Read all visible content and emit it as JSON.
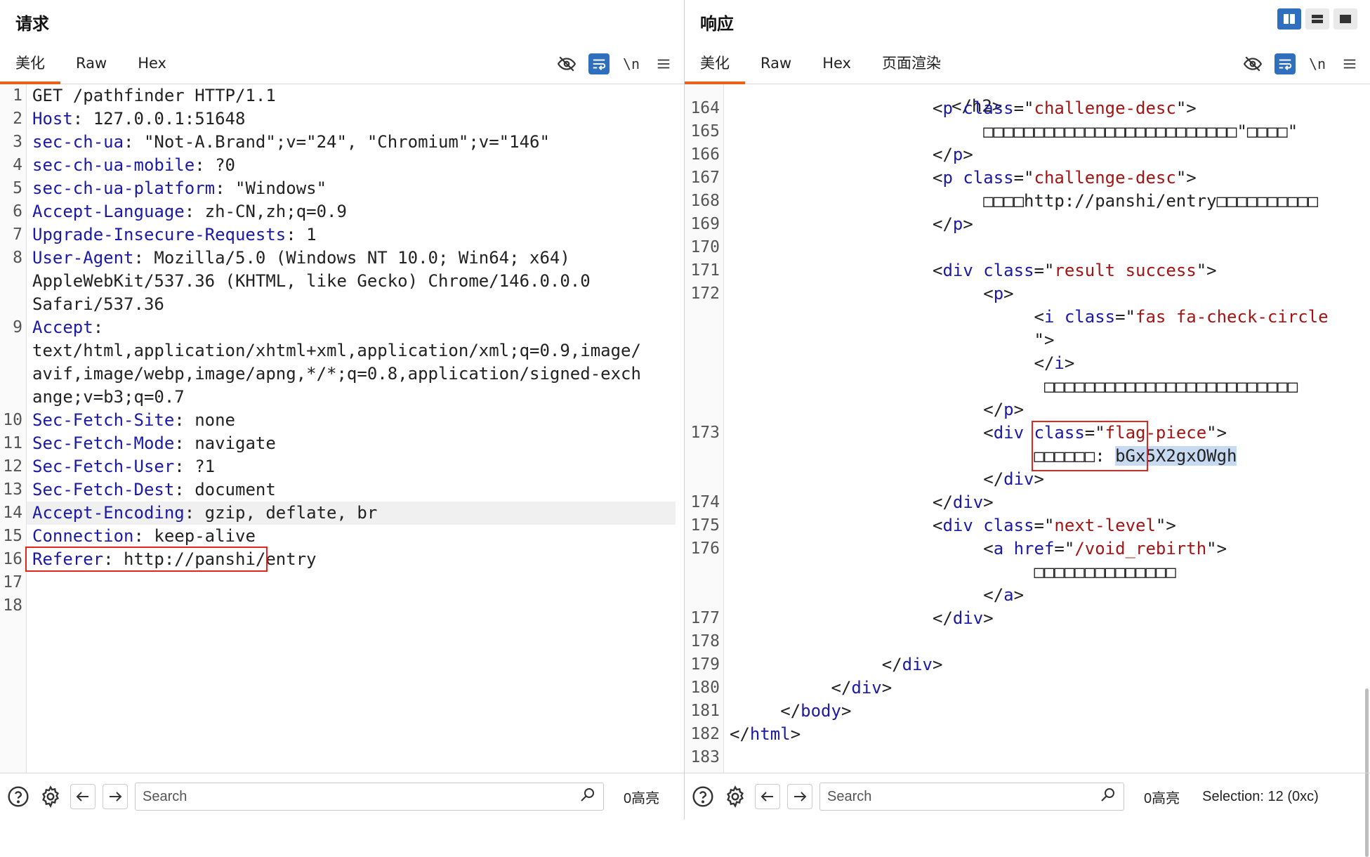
{
  "request": {
    "title": "请求",
    "tabs": [
      "美化",
      "Raw",
      "Hex"
    ],
    "active_tab": "美化",
    "newline_label": "\\n",
    "lines": [
      {
        "n": "1",
        "parts": [
          {
            "c": "v",
            "t": "GET /pathfinder HTTP/1.1"
          }
        ]
      },
      {
        "n": "2",
        "parts": [
          {
            "c": "k",
            "t": "Host"
          },
          {
            "c": "v",
            "t": ": 127.0.0.1:51648"
          }
        ]
      },
      {
        "n": "3",
        "parts": [
          {
            "c": "k",
            "t": "sec-ch-ua"
          },
          {
            "c": "v",
            "t": ": \"Not-A.Brand\";v=\"24\", \"Chromium\";v=\"146\""
          }
        ]
      },
      {
        "n": "4",
        "parts": [
          {
            "c": "k",
            "t": "sec-ch-ua-mobile"
          },
          {
            "c": "v",
            "t": ": ?0"
          }
        ]
      },
      {
        "n": "5",
        "parts": [
          {
            "c": "k",
            "t": "sec-ch-ua-platform"
          },
          {
            "c": "v",
            "t": ": \"Windows\""
          }
        ]
      },
      {
        "n": "6",
        "parts": [
          {
            "c": "k",
            "t": "Accept-Language"
          },
          {
            "c": "v",
            "t": ": zh-CN,zh;q=0.9"
          }
        ]
      },
      {
        "n": "7",
        "parts": [
          {
            "c": "k",
            "t": "Upgrade-Insecure-Requests"
          },
          {
            "c": "v",
            "t": ": 1"
          }
        ]
      },
      {
        "n": "8",
        "parts": [
          {
            "c": "k",
            "t": "User-Agent"
          },
          {
            "c": "v",
            "t": ": Mozilla/5.0 (Windows NT 10.0; Win64; x64)"
          }
        ]
      },
      {
        "n": "",
        "parts": [
          {
            "c": "v",
            "t": "AppleWebKit/537.36 (KHTML, like Gecko) Chrome/146.0.0.0"
          }
        ]
      },
      {
        "n": "",
        "parts": [
          {
            "c": "v",
            "t": "Safari/537.36"
          }
        ]
      },
      {
        "n": "9",
        "parts": [
          {
            "c": "k",
            "t": "Accept"
          },
          {
            "c": "v",
            "t": ":"
          }
        ]
      },
      {
        "n": "",
        "parts": [
          {
            "c": "v",
            "t": "text/html,application/xhtml+xml,application/xml;q=0.9,image/"
          }
        ]
      },
      {
        "n": "",
        "parts": [
          {
            "c": "v",
            "t": "avif,image/webp,image/apng,*/*;q=0.8,application/signed-exch"
          }
        ]
      },
      {
        "n": "",
        "parts": [
          {
            "c": "v",
            "t": "ange;v=b3;q=0.7"
          }
        ]
      },
      {
        "n": "10",
        "parts": [
          {
            "c": "k",
            "t": "Sec-Fetch-Site"
          },
          {
            "c": "v",
            "t": ": none"
          }
        ]
      },
      {
        "n": "11",
        "parts": [
          {
            "c": "k",
            "t": "Sec-Fetch-Mode"
          },
          {
            "c": "v",
            "t": ": navigate"
          }
        ]
      },
      {
        "n": "12",
        "parts": [
          {
            "c": "k",
            "t": "Sec-Fetch-User"
          },
          {
            "c": "v",
            "t": ": ?1"
          }
        ]
      },
      {
        "n": "13",
        "parts": [
          {
            "c": "k",
            "t": "Sec-Fetch-Dest"
          },
          {
            "c": "v",
            "t": ": document"
          }
        ]
      },
      {
        "n": "14",
        "hl": true,
        "parts": [
          {
            "c": "k",
            "t": "Accept-Encoding"
          },
          {
            "c": "v",
            "t": ": gzip, deflate, br"
          }
        ]
      },
      {
        "n": "15",
        "parts": [
          {
            "c": "k",
            "t": "Connection"
          },
          {
            "c": "v",
            "t": ": keep-alive"
          }
        ]
      },
      {
        "n": "16",
        "box": true,
        "parts": [
          {
            "c": "k",
            "t": "Referer"
          },
          {
            "c": "v",
            "t": ": http://panshi/entry"
          }
        ]
      },
      {
        "n": "17",
        "parts": []
      },
      {
        "n": "18",
        "parts": []
      }
    ],
    "search_placeholder": "Search",
    "highlight_count": "0高亮"
  },
  "response": {
    "title": "响应",
    "tabs": [
      "美化",
      "Raw",
      "Hex",
      "页面渲染"
    ],
    "active_tab": "美化",
    "newline_label": "\\n",
    "top_partial": "</h2>",
    "lines": [
      {
        "n": "164",
        "indent": 10,
        "parts": [
          {
            "c": "pun",
            "t": "<"
          },
          {
            "c": "tg",
            "t": "p"
          },
          {
            "c": "pun",
            "t": " "
          },
          {
            "c": "at",
            "t": "class"
          },
          {
            "c": "pun",
            "t": "=\""
          },
          {
            "c": "st",
            "t": "challenge-desc"
          },
          {
            "c": "pun",
            "t": "\">"
          }
        ]
      },
      {
        "n": "165",
        "indent": 15,
        "parts": [
          {
            "c": "v",
            "t": "□□□□□□□□□□□□□□□□□□□□□□□□□\"□□□□\""
          }
        ]
      },
      {
        "n": "166",
        "indent": 10,
        "parts": [
          {
            "c": "pun",
            "t": "</"
          },
          {
            "c": "tg",
            "t": "p"
          },
          {
            "c": "pun",
            "t": ">"
          }
        ]
      },
      {
        "n": "167",
        "indent": 10,
        "parts": [
          {
            "c": "pun",
            "t": "<"
          },
          {
            "c": "tg",
            "t": "p"
          },
          {
            "c": "pun",
            "t": " "
          },
          {
            "c": "at",
            "t": "class"
          },
          {
            "c": "pun",
            "t": "=\""
          },
          {
            "c": "st",
            "t": "challenge-desc"
          },
          {
            "c": "pun",
            "t": "\">"
          }
        ]
      },
      {
        "n": "168",
        "indent": 15,
        "parts": [
          {
            "c": "v",
            "t": "□□□□http://panshi/entry□□□□□□□□□□"
          }
        ]
      },
      {
        "n": "169",
        "indent": 10,
        "parts": [
          {
            "c": "pun",
            "t": "</"
          },
          {
            "c": "tg",
            "t": "p"
          },
          {
            "c": "pun",
            "t": ">"
          }
        ]
      },
      {
        "n": "170",
        "indent": 0,
        "parts": []
      },
      {
        "n": "171",
        "indent": 10,
        "parts": [
          {
            "c": "pun",
            "t": "<"
          },
          {
            "c": "tg",
            "t": "div"
          },
          {
            "c": "pun",
            "t": " "
          },
          {
            "c": "at",
            "t": "class"
          },
          {
            "c": "pun",
            "t": "=\""
          },
          {
            "c": "st",
            "t": "result success"
          },
          {
            "c": "pun",
            "t": "\">"
          }
        ]
      },
      {
        "n": "172",
        "indent": 15,
        "parts": [
          {
            "c": "pun",
            "t": "<"
          },
          {
            "c": "tg",
            "t": "p"
          },
          {
            "c": "pun",
            "t": ">"
          }
        ]
      },
      {
        "n": "",
        "indent": 20,
        "parts": [
          {
            "c": "pun",
            "t": "<"
          },
          {
            "c": "tg",
            "t": "i"
          },
          {
            "c": "pun",
            "t": " "
          },
          {
            "c": "at",
            "t": "class"
          },
          {
            "c": "pun",
            "t": "=\""
          },
          {
            "c": "st",
            "t": "fas fa-check-circle"
          }
        ]
      },
      {
        "n": "",
        "indent": 20,
        "parts": [
          {
            "c": "pun",
            "t": "\">"
          }
        ]
      },
      {
        "n": "",
        "indent": 20,
        "parts": [
          {
            "c": "pun",
            "t": "</"
          },
          {
            "c": "tg",
            "t": "i"
          },
          {
            "c": "pun",
            "t": ">"
          }
        ]
      },
      {
        "n": "",
        "indent": 21,
        "parts": [
          {
            "c": "v",
            "t": "□□□□□□□□□□□□□□□□□□□□□□□□□"
          }
        ]
      },
      {
        "n": "",
        "indent": 15,
        "parts": [
          {
            "c": "pun",
            "t": "</"
          },
          {
            "c": "tg",
            "t": "p"
          },
          {
            "c": "pun",
            "t": ">"
          }
        ]
      },
      {
        "n": "173",
        "indent": 15,
        "parts": [
          {
            "c": "pun",
            "t": "<"
          },
          {
            "c": "tg",
            "t": "div"
          },
          {
            "c": "pun",
            "t": " "
          },
          {
            "c": "at",
            "t": "class"
          },
          {
            "c": "pun",
            "t": "=\""
          },
          {
            "c": "st",
            "t": "flag-piece"
          },
          {
            "c": "pun",
            "t": "\">"
          }
        ]
      },
      {
        "n": "",
        "indent": 20,
        "flag": true,
        "parts": [
          {
            "c": "v",
            "t": "□□□□□□: "
          },
          {
            "c": "sel",
            "t": "bGx5X2gxOWgh"
          }
        ]
      },
      {
        "n": "",
        "indent": 15,
        "parts": [
          {
            "c": "pun",
            "t": "</"
          },
          {
            "c": "tg",
            "t": "div"
          },
          {
            "c": "pun",
            "t": ">"
          }
        ]
      },
      {
        "n": "174",
        "indent": 10,
        "parts": [
          {
            "c": "pun",
            "t": "</"
          },
          {
            "c": "tg",
            "t": "div"
          },
          {
            "c": "pun",
            "t": ">"
          }
        ]
      },
      {
        "n": "175",
        "indent": 10,
        "parts": [
          {
            "c": "pun",
            "t": "<"
          },
          {
            "c": "tg",
            "t": "div"
          },
          {
            "c": "pun",
            "t": " "
          },
          {
            "c": "at",
            "t": "class"
          },
          {
            "c": "pun",
            "t": "=\""
          },
          {
            "c": "st",
            "t": "next-level"
          },
          {
            "c": "pun",
            "t": "\">"
          }
        ]
      },
      {
        "n": "176",
        "indent": 15,
        "parts": [
          {
            "c": "pun",
            "t": "<"
          },
          {
            "c": "tg",
            "t": "a"
          },
          {
            "c": "pun",
            "t": " "
          },
          {
            "c": "at",
            "t": "href"
          },
          {
            "c": "pun",
            "t": "=\""
          },
          {
            "c": "st",
            "t": "/void_rebirth"
          },
          {
            "c": "pun",
            "t": "\">"
          }
        ]
      },
      {
        "n": "",
        "indent": 20,
        "parts": [
          {
            "c": "v",
            "t": "□□□□□□□□□□□□□□"
          }
        ]
      },
      {
        "n": "",
        "indent": 15,
        "parts": [
          {
            "c": "pun",
            "t": "</"
          },
          {
            "c": "tg",
            "t": "a"
          },
          {
            "c": "pun",
            "t": ">"
          }
        ]
      },
      {
        "n": "177",
        "indent": 10,
        "parts": [
          {
            "c": "pun",
            "t": "</"
          },
          {
            "c": "tg",
            "t": "div"
          },
          {
            "c": "pun",
            "t": ">"
          }
        ]
      },
      {
        "n": "178",
        "indent": 0,
        "parts": []
      },
      {
        "n": "179",
        "indent": 5,
        "parts": [
          {
            "c": "pun",
            "t": "</"
          },
          {
            "c": "tg",
            "t": "div"
          },
          {
            "c": "pun",
            "t": ">"
          }
        ]
      },
      {
        "n": "180",
        "indent": 0,
        "parts": [
          {
            "c": "pun",
            "t": "</"
          },
          {
            "c": "tg",
            "t": "div"
          },
          {
            "c": "pun",
            "t": ">"
          }
        ]
      },
      {
        "n": "181",
        "indent": -5,
        "parts": [
          {
            "c": "pun",
            "t": "</"
          },
          {
            "c": "tg",
            "t": "body"
          },
          {
            "c": "pun",
            "t": ">"
          }
        ]
      },
      {
        "n": "182",
        "indent": -10,
        "parts": [
          {
            "c": "pun",
            "t": "</"
          },
          {
            "c": "tg",
            "t": "html"
          },
          {
            "c": "pun",
            "t": ">"
          }
        ]
      },
      {
        "n": "183",
        "indent": 0,
        "parts": []
      }
    ],
    "search_placeholder": "Search",
    "highlight_count": "0高亮",
    "selection": "Selection: 12 (0xc)"
  },
  "icons": {
    "eye_off": "eye-off-icon",
    "wrap": "wrap-icon",
    "menu": "menu-icon",
    "help": "help-icon",
    "gear": "gear-icon",
    "back": "arrow-left-icon",
    "forward": "arrow-right-icon",
    "search": "search-icon",
    "layout_split": "layout-split-icon",
    "layout_stack": "layout-stack-icon",
    "layout_single": "layout-single-icon"
  },
  "colors": {
    "accent_tab": "#e8621b",
    "tool_active": "#2f6fbd",
    "header_key": "#1a1aa6",
    "string": "#a31515",
    "highlight_box": "#e0261f",
    "selection": "#c7daf1"
  }
}
